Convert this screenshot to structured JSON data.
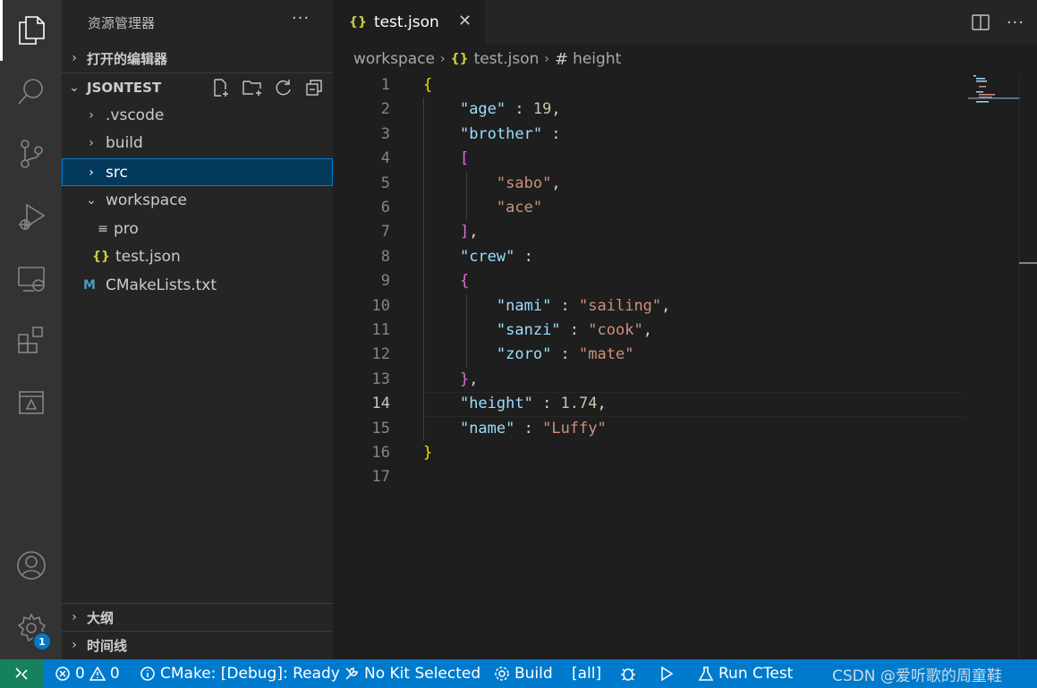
{
  "sidebar": {
    "title": "资源管理器",
    "more": "···",
    "open_editors": "打开的编辑器",
    "workspace_folder": "JSONTEST",
    "tree": [
      {
        "label": ".vscode",
        "icon": "chevron-right"
      },
      {
        "label": "build",
        "icon": "chevron-right"
      },
      {
        "label": "src",
        "icon": "chevron-right"
      },
      {
        "label": "workspace",
        "icon": "chevron-down"
      },
      {
        "label": "pro",
        "icon": "lines-icon"
      },
      {
        "label": "test.json",
        "icon": "json-braces",
        "icon_text": "{}"
      },
      {
        "label": "CMakeLists.txt",
        "icon": "cmake-m",
        "icon_text": "M"
      }
    ],
    "outline": "大纲",
    "timeline": "时间线"
  },
  "activity": {
    "settings_badge": "1"
  },
  "editor": {
    "tab_label": "test.json",
    "tab_icon": "{}",
    "tab_close": "✕",
    "tab_more": "···",
    "breadcrumb": {
      "folder": "workspace",
      "file_icon": "{}",
      "file": "test.json",
      "symbol_icon": "#",
      "symbol": "height"
    },
    "current_line": 14,
    "line_numbers": [
      "1",
      "2",
      "3",
      "4",
      "5",
      "6",
      "7",
      "8",
      "9",
      "10",
      "11",
      "12",
      "13",
      "14",
      "15",
      "16",
      "17"
    ]
  },
  "status": {
    "errors": "0",
    "warnings": "0",
    "cmake": "CMake: [Debug]: Ready",
    "kit": "No Kit Selected",
    "build": "Build",
    "target": "[all]",
    "run_ctest": "Run CTest",
    "watermark": "CSDN @爱听歌的周童鞋"
  },
  "colors": {
    "accent": "#007acc",
    "remote": "#16825d",
    "key": "#9cdcfe",
    "string": "#ce9178",
    "number": "#b5cea8",
    "bracket_level1": "#ffd700",
    "bracket_level2": "#da70d6"
  }
}
